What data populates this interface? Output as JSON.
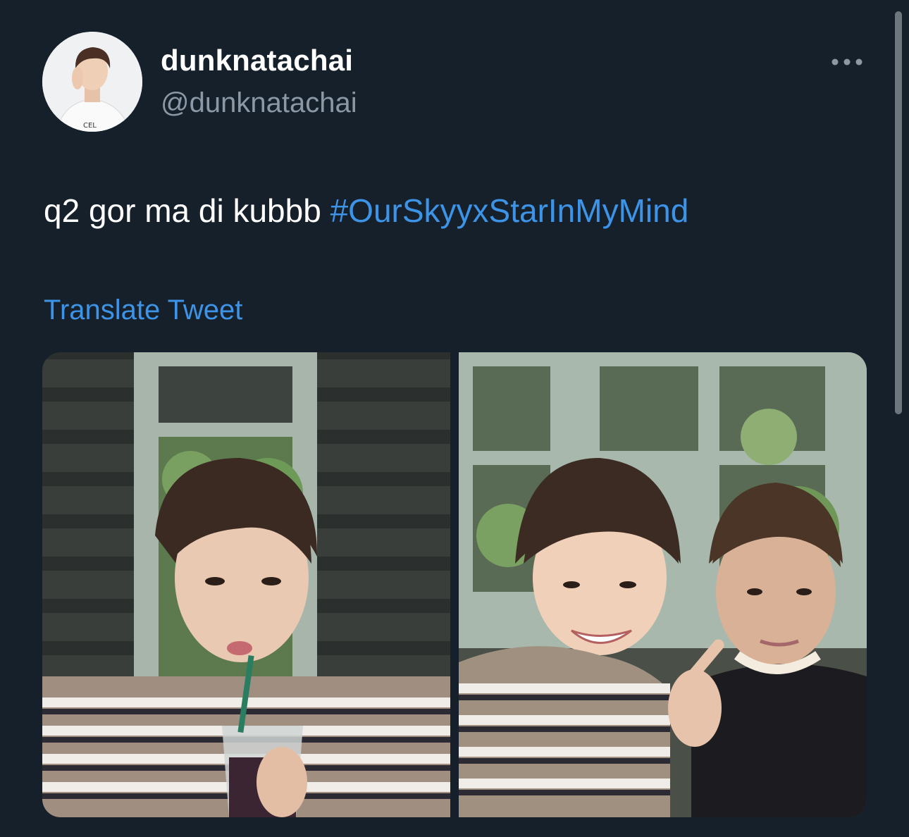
{
  "tweet": {
    "display_name": "dunknatachai",
    "handle": "@dunknatachai",
    "text": "q2 gor ma di kubbb ",
    "hashtag": "#OurSkyyxStarInMyMind",
    "translate_label": "Translate Tweet",
    "media": [
      {
        "name": "photo-1",
        "icon": "photo"
      },
      {
        "name": "photo-2",
        "icon": "photo"
      }
    ]
  },
  "colors": {
    "background": "#15202b",
    "primary_text": "#ffffff",
    "secondary_text": "#8b98a5",
    "accent": "#3d93e6"
  }
}
